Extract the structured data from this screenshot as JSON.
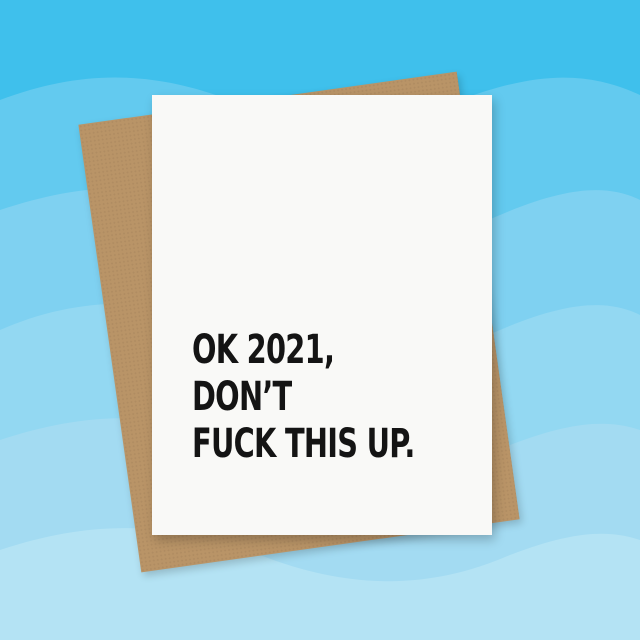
{
  "background": {
    "color": "#4cc3ea",
    "wave_colors": [
      "#3fc0ec",
      "#6dcdf0",
      "#8fd7f2",
      "#9fd9f0",
      "#b4e3f4"
    ]
  },
  "envelope": {
    "color": "#b99467"
  },
  "card": {
    "color": "#f9f9f7",
    "lines": [
      "OK 2021,",
      "DON’T",
      "FUCK THIS UP."
    ]
  }
}
